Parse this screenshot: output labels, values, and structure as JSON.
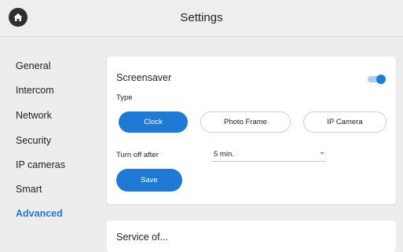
{
  "header": {
    "title": "Settings",
    "home_icon": "home-icon"
  },
  "sidebar": {
    "items": [
      {
        "label": "General"
      },
      {
        "label": "Intercom"
      },
      {
        "label": "Network"
      },
      {
        "label": "Security"
      },
      {
        "label": "IP cameras"
      },
      {
        "label": "Smart"
      },
      {
        "label": "Advanced",
        "active": true
      }
    ]
  },
  "screensaver": {
    "title": "Screensaver",
    "enabled": true,
    "type_label": "Type",
    "types": [
      {
        "label": "Clock",
        "selected": true
      },
      {
        "label": "Photo Frame",
        "selected": false
      },
      {
        "label": "IP Camera",
        "selected": false
      }
    ],
    "turn_off_label": "Turn off after",
    "turn_off_value": "5 min.",
    "save_label": "Save"
  },
  "next_section": {
    "title": "Service of..."
  },
  "colors": {
    "accent": "#1f7ad6",
    "background": "#ededed",
    "card": "#ffffff"
  }
}
